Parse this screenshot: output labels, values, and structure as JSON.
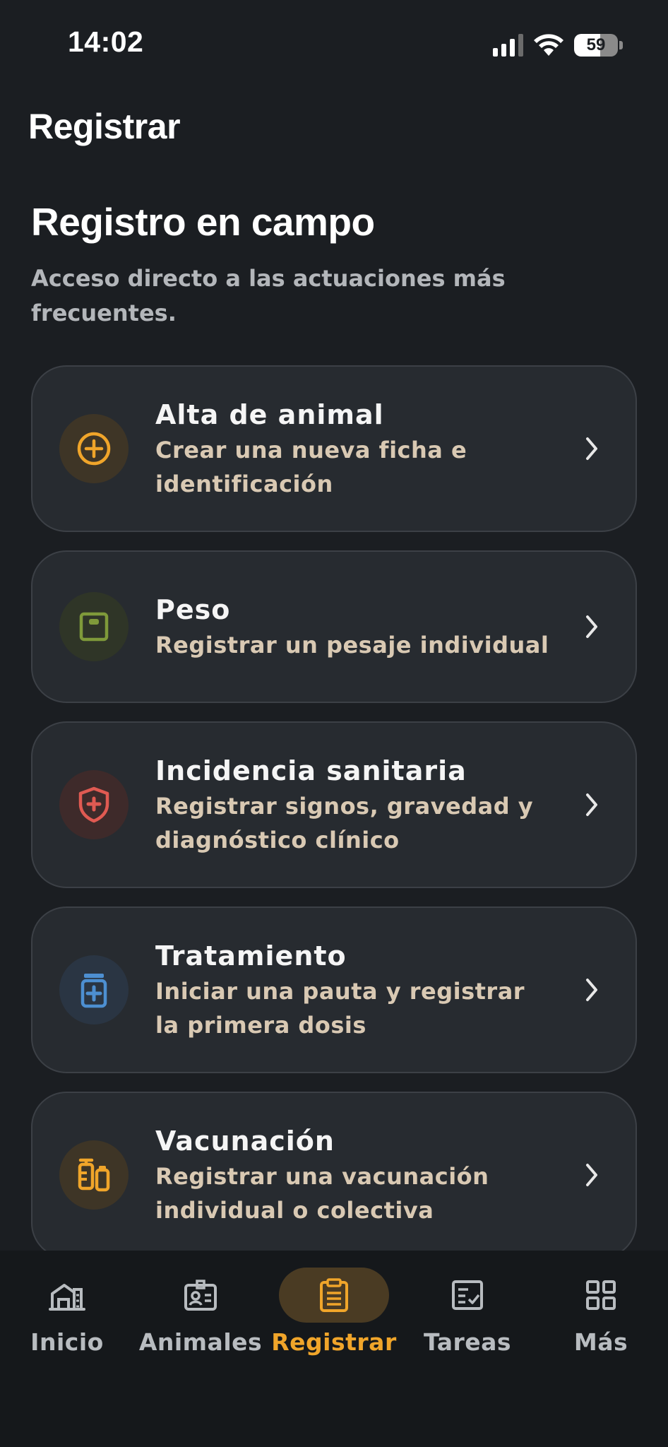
{
  "status_bar": {
    "time": "14:02",
    "battery": "59",
    "battery_level": 0.59
  },
  "header": {
    "title": "Registrar"
  },
  "section": {
    "title": "Registro en campo",
    "subtitle": "Acceso directo a las actuaciones más frecuentes."
  },
  "actions": [
    {
      "title": "Alta de animal",
      "desc": "Crear una nueva ficha e identificación",
      "icon": "plus-circle-icon",
      "color": "#f0a52a"
    },
    {
      "title": "Peso",
      "desc": "Registrar un pesaje individual",
      "icon": "scale-icon",
      "color": "#7f9a3a"
    },
    {
      "title": "Incidencia sanitaria",
      "desc": "Registrar signos, gravedad y diagnóstico clínico",
      "icon": "shield-plus-icon",
      "color": "#e05a52"
    },
    {
      "title": "Tratamiento",
      "desc": "Iniciar una pauta y registrar la primera dosis",
      "icon": "medicine-jar-icon",
      "color": "#4d8fd1"
    },
    {
      "title": "Vacunación",
      "desc": "Registrar una vacunación individual o colectiva",
      "icon": "vaccine-icon",
      "color": "#f0a52a"
    }
  ],
  "tabs": [
    {
      "label": "Inicio",
      "icon": "farm-icon",
      "active": false
    },
    {
      "label": "Animales",
      "icon": "animal-id-icon",
      "active": false
    },
    {
      "label": "Registrar",
      "icon": "clipboard-icon",
      "active": true
    },
    {
      "label": "Tareas",
      "icon": "task-check-icon",
      "active": false
    },
    {
      "label": "Más",
      "icon": "grid-icon",
      "active": false
    }
  ],
  "colors": {
    "background": "#1b1e22",
    "card": "#272b30",
    "accent": "#f0a52a",
    "description": "#d9c9b3"
  }
}
